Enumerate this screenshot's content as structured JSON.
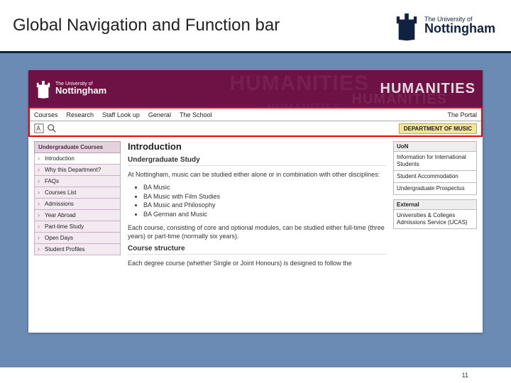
{
  "slide": {
    "title": "Global Navigation and Function bar",
    "page_number": "11"
  },
  "brand": {
    "pre": "The University of",
    "name": "Nottingham"
  },
  "banner": {
    "faculty": "HUMANITIES"
  },
  "globalnav": {
    "items": [
      "Courses",
      "Research",
      "Staff Look up",
      "General",
      "The School"
    ],
    "right_item": "The Portal",
    "dept_badge": "DEPARTMENT OF MUSIC"
  },
  "leftnav": {
    "heading": "Undergraduate Courses",
    "items": [
      "Introduction",
      "Why this Department?",
      "FAQs",
      "Courses List",
      "Admissions",
      "Year Abroad",
      "Part-time Study",
      "Open Days",
      "Student Profiles"
    ]
  },
  "main": {
    "h2": "Introduction",
    "h3a": "Undergraduate Study",
    "p1": "At Nottingham, music can be studied either alone or in combination with other disciplines:",
    "bullets": [
      "BA Music",
      "BA Music with Film Studies",
      "BA Music and Philosophy",
      "BA German and Music"
    ],
    "p2": "Each course, consisting of core and optional modules, can be studied either full-time (three years) or part-time (normally six years).",
    "h3b": "Course structure",
    "p3": "Each degree course (whether Single or Joint Honours) is designed to follow the"
  },
  "rightcol": {
    "box1_head": "UoN",
    "box1_links": [
      "Information for International Students",
      "Student Accommodation",
      "Undergraduate Prospectus"
    ],
    "box2_head": "External",
    "box2_links": [
      "Universities & Colleges Admissions Service (UCAS)"
    ]
  }
}
